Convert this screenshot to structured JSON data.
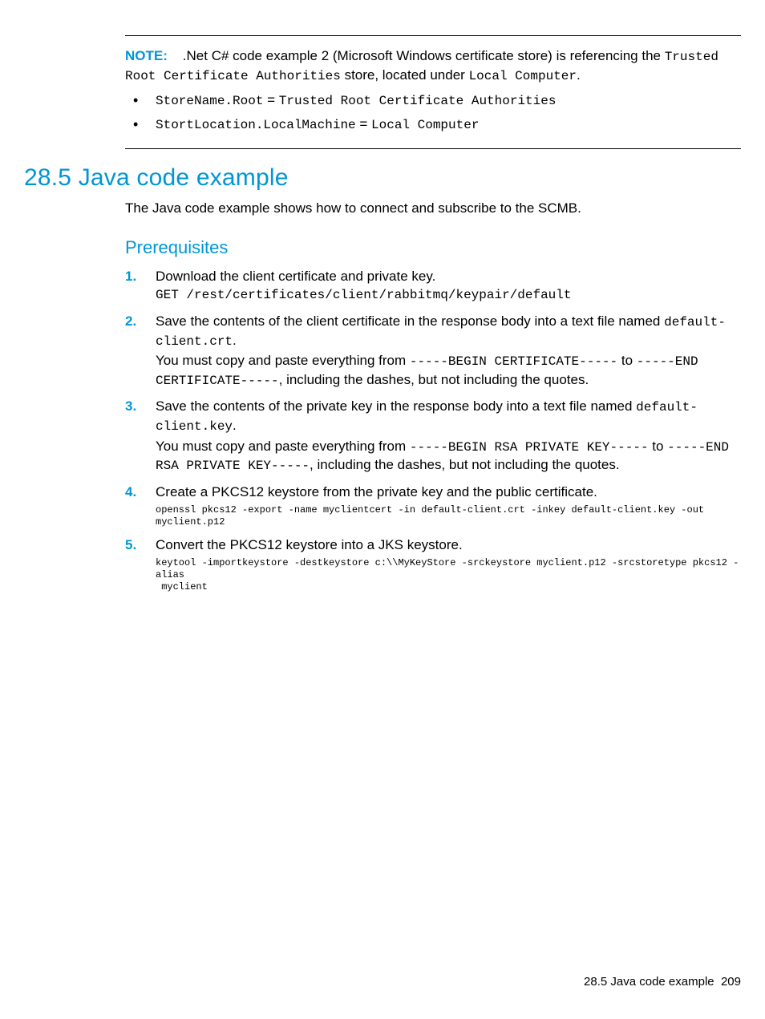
{
  "note": {
    "label": "NOTE:",
    "text_a": ".Net C# code example 2 (Microsoft Windows certificate store) is referencing the ",
    "text_b": "Trusted Root Certificate Authorities",
    "text_c": " store, located under ",
    "text_d": "Local Computer",
    "text_e": ".",
    "bullets": [
      {
        "a": "StoreName.Root",
        "eq": " = ",
        "b": "Trusted Root Certificate Authorities"
      },
      {
        "a": "StortLocation.LocalMachine",
        "eq": " = ",
        "b": "Local Computer"
      }
    ]
  },
  "section": {
    "number": "28.5",
    "title": "Java code example",
    "full": "28.5 Java code example",
    "intro": "The Java code example shows how to connect and subscribe to the SCMB."
  },
  "prereq": {
    "heading": "Prerequisites",
    "steps": {
      "s1": {
        "text": "Download the client certificate and private key.",
        "cmd": "GET /rest/certificates/client/rabbitmq/keypair/default"
      },
      "s2": {
        "a": "Save the contents of the client certificate in the response body into a text file named ",
        "file": "default-client.crt",
        "b": ".",
        "c": "You must copy and paste everything from ",
        "begin": "-----BEGIN CERTIFICATE-----",
        "d": " to ",
        "end": "-----END CERTIFICATE-----",
        "e": ", including the dashes, but not including the quotes."
      },
      "s3": {
        "a": "Save the contents of the private key in the response body into a text file named ",
        "file": "default-client.key",
        "b": ".",
        "c": "You must copy and paste everything from ",
        "begin": "-----BEGIN RSA PRIVATE KEY-----",
        "d": " to ",
        "end": "-----END RSA PRIVATE KEY-----",
        "e": ", including the dashes, but not including the quotes."
      },
      "s4": {
        "text": "Create a PKCS12 keystore from the private key and the public certificate.",
        "cmd": "openssl pkcs12 -export -name myclientcert -in default-client.crt -inkey default-client.key -out myclient.p12"
      },
      "s5": {
        "text": "Convert the PKCS12 keystore into a JKS keystore.",
        "cmd": "keytool -importkeystore -destkeystore c:\\\\MyKeyStore -srckeystore myclient.p12 -srcstoretype pkcs12 -alias\n myclient"
      }
    }
  },
  "footer": {
    "title": "28.5 Java code example",
    "page": "209"
  }
}
